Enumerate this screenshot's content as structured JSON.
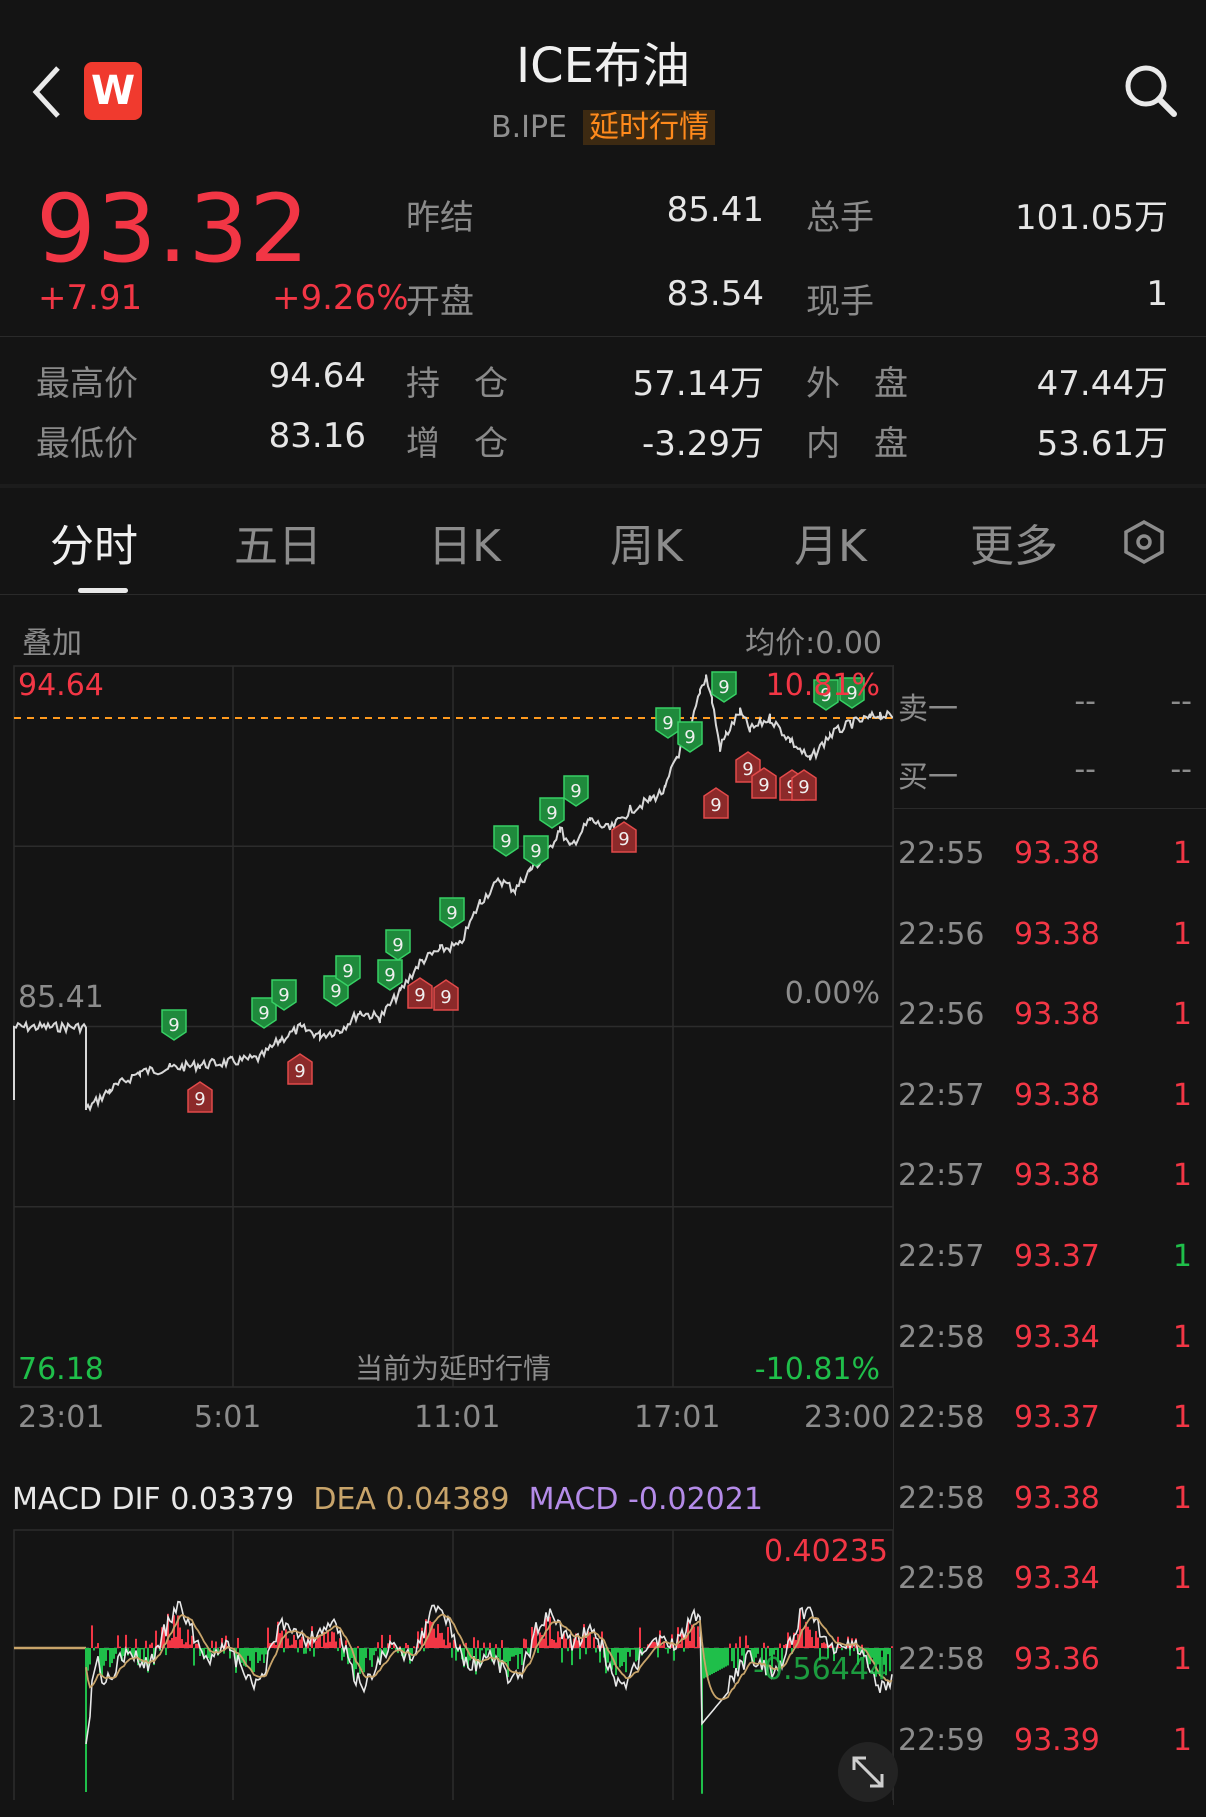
{
  "header": {
    "title": "ICE布油",
    "code": "B.IPE",
    "delay_tag": "延时行情",
    "logo_letter": "W"
  },
  "quote": {
    "price": "93.32",
    "change": "+7.91",
    "change_pct": "+9.26%",
    "prev_settle_label": "昨结",
    "prev_settle": "85.41",
    "total_vol_label": "总手",
    "total_vol": "101.05万",
    "open_label": "开盘",
    "open": "83.54",
    "cur_vol_label": "现手",
    "cur_vol": "1",
    "high_label": "最高价",
    "high": "94.64",
    "oi_label": "持　仓",
    "oi": "57.14万",
    "outer_label": "外　盘",
    "outer": "47.44万",
    "low_label": "最低价",
    "low": "83.16",
    "oi_chg_label": "增　仓",
    "oi_chg": "-3.29万",
    "inner_label": "内　盘",
    "inner": "53.61万"
  },
  "tabs": [
    "分时",
    "五日",
    "日K",
    "周K",
    "月K",
    "更多"
  ],
  "chart": {
    "overlay_label": "叠加",
    "avg_label": "均价:0.00",
    "y_top": "94.64",
    "y_mid": "85.41",
    "y_bottom": "76.18",
    "pct_top": "10.81%",
    "pct_mid": "0.00%",
    "pct_bottom": "-10.81%",
    "delay_note": "当前为延时行情",
    "x_labels": [
      "23:01",
      "5:01",
      "11:01",
      "17:01",
      "23:00"
    ]
  },
  "macd": {
    "dif_label": "MACD DIF 0.03379",
    "dea_label": "DEA 0.04389",
    "macd_label": "MACD -0.02021",
    "max_label": "0.40235",
    "min_label": "-0.56444"
  },
  "orderbook": {
    "ask_label": "卖一",
    "ask_price": "--",
    "ask_vol": "--",
    "bid_label": "买一",
    "bid_price": "--",
    "bid_vol": "--",
    "ticks": [
      {
        "time": "22:55",
        "price": "93.38",
        "vol": "1",
        "side": "red"
      },
      {
        "time": "22:56",
        "price": "93.38",
        "vol": "1",
        "side": "red"
      },
      {
        "time": "22:56",
        "price": "93.38",
        "vol": "1",
        "side": "red"
      },
      {
        "time": "22:57",
        "price": "93.38",
        "vol": "1",
        "side": "red"
      },
      {
        "time": "22:57",
        "price": "93.38",
        "vol": "1",
        "side": "red"
      },
      {
        "time": "22:57",
        "price": "93.37",
        "vol": "1",
        "side": "green"
      },
      {
        "time": "22:58",
        "price": "93.34",
        "vol": "1",
        "side": "red"
      },
      {
        "time": "22:58",
        "price": "93.37",
        "vol": "1",
        "side": "red"
      },
      {
        "time": "22:58",
        "price": "93.38",
        "vol": "1",
        "side": "red"
      },
      {
        "time": "22:58",
        "price": "93.34",
        "vol": "1",
        "side": "red"
      },
      {
        "time": "22:58",
        "price": "93.36",
        "vol": "1",
        "side": "red"
      },
      {
        "time": "22:59",
        "price": "93.39",
        "vol": "1",
        "side": "red"
      }
    ]
  },
  "colors": {
    "up": "#f23645",
    "down": "#1fbf4a",
    "dash": "#ff9a1e",
    "dea": "#c8a46a",
    "macd": "#b48be8"
  }
}
